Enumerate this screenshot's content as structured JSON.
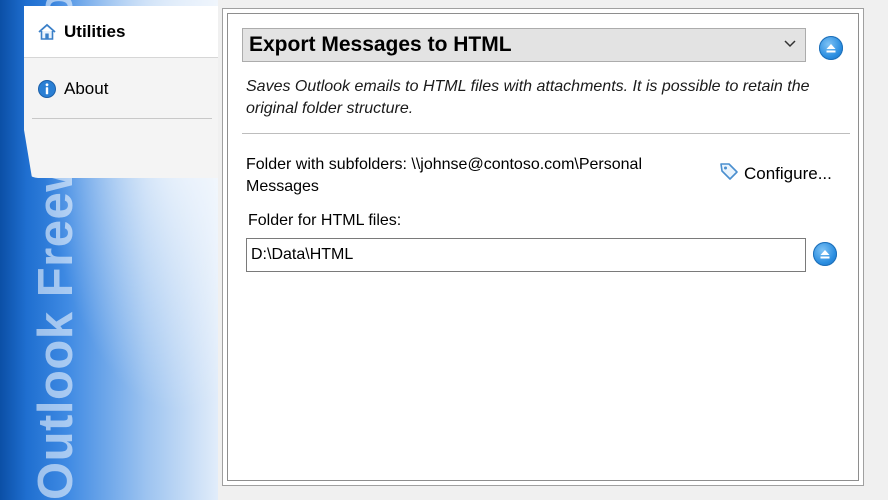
{
  "sidebar": {
    "watermark": "Outlook Freeware .com",
    "tabs": [
      {
        "label": "Utilities",
        "icon": "home-icon",
        "active": true
      },
      {
        "label": "About",
        "icon": "info-icon",
        "active": false
      }
    ]
  },
  "main": {
    "action_select": {
      "value": "Export Messages to HTML"
    },
    "description": "Saves Outlook emails to HTML files with attachments. It is possible to retain the original folder structure.",
    "folder_with_subfolders": "Folder with subfolders: \\\\johnse@contoso.com\\Personal Messages",
    "configure_label": "Configure...",
    "html_folder_label": "Folder for HTML files:",
    "html_folder_value": "D:\\Data\\HTML"
  },
  "colors": {
    "accent_blue": "#2a8de0",
    "sidebar_blue": "#1f6fd0"
  }
}
